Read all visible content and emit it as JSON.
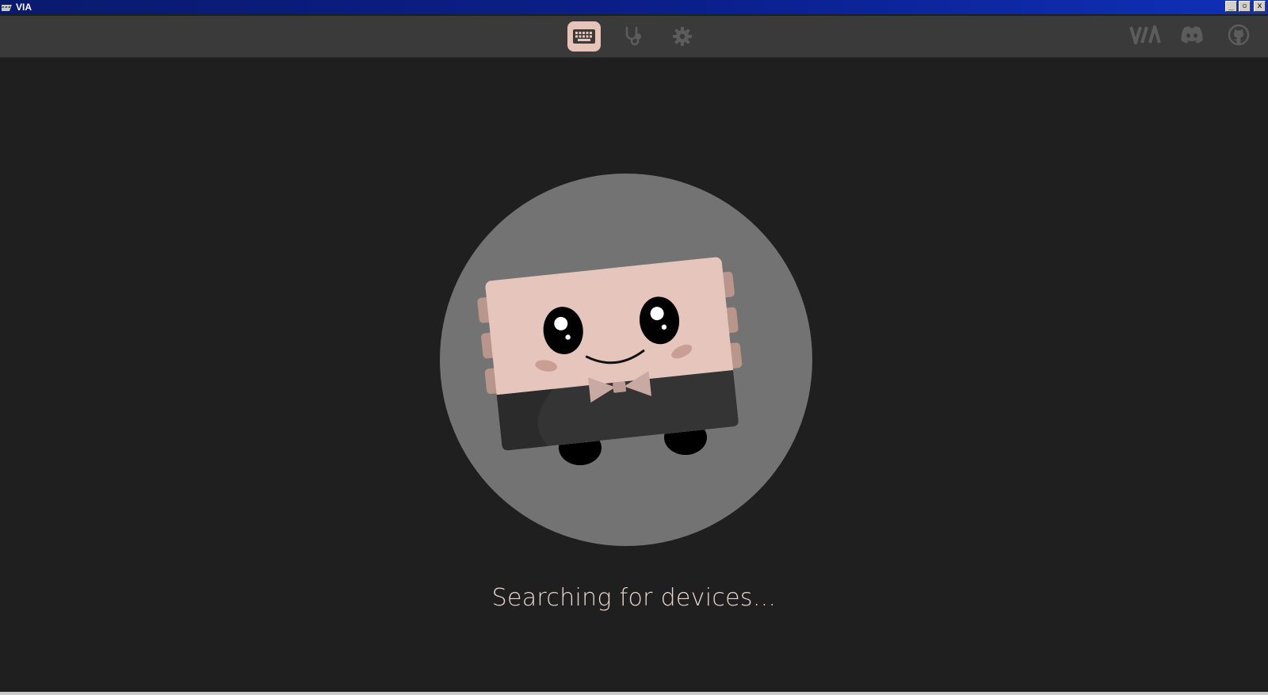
{
  "window": {
    "title": "VIA",
    "app_icon": "via-app-icon",
    "controls": {
      "minimize_label": "_",
      "maximize_label": "▫",
      "close_label": "x"
    }
  },
  "toolbar": {
    "nav": [
      {
        "name": "configure",
        "icon": "keyboard-icon",
        "active": true
      },
      {
        "name": "test",
        "icon": "stethoscope-icon",
        "active": false
      },
      {
        "name": "settings",
        "icon": "gear-icon",
        "active": false
      }
    ],
    "external": [
      {
        "name": "via-website",
        "icon": "via-logo-icon"
      },
      {
        "name": "discord",
        "icon": "discord-icon"
      },
      {
        "name": "github",
        "icon": "github-icon"
      }
    ]
  },
  "main": {
    "illustration": "keyboard-mascot-illustration",
    "status_text": "Searching for devices..."
  },
  "colors": {
    "accent": "#e8c4b8",
    "toolbar_bg": "#3a3a3a",
    "main_bg": "#1f1f1f",
    "circle_bg": "#737373",
    "icon_muted": "#5c5c5c"
  }
}
